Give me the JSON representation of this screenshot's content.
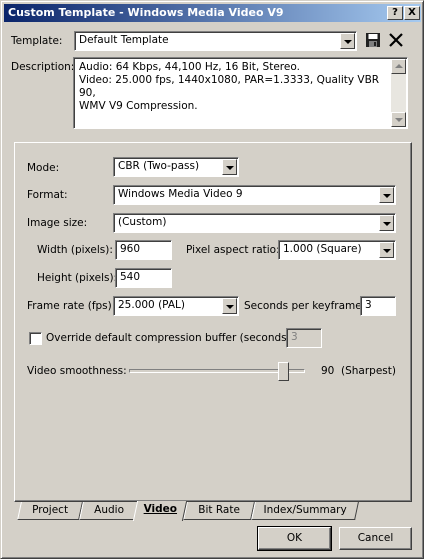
{
  "window": {
    "title": "Custom Template - Windows Media Video V9",
    "help_label": "?",
    "close_label": "X"
  },
  "template": {
    "label": "Template:",
    "value": "Default Template",
    "save_icon": "floppy-save-icon",
    "delete_icon": "delete-x-icon"
  },
  "description": {
    "label": "Description:",
    "text": "Audio: 64 Kbps, 44,100 Hz, 16 Bit, Stereo.\nVideo: 25.000 fps, 1440x1080, PAR=1.3333, Quality VBR 90,\nWMV V9 Compression."
  },
  "video": {
    "mode_label": "Mode:",
    "mode_value": "CBR (Two-pass)",
    "format_label": "Format:",
    "format_value": "Windows Media Video 9",
    "image_size_label": "Image size:",
    "image_size_value": "(Custom)",
    "width_label": "Width (pixels):",
    "width_value": "960",
    "par_label": "Pixel aspect ratio:",
    "par_value": "1.000 (Square)",
    "height_label": "Height (pixels):",
    "height_value": "540",
    "frame_rate_label": "Frame rate (fps):",
    "frame_rate_value": "25.000 (PAL)",
    "keyframe_label": "Seconds per keyframe:",
    "keyframe_value": "3",
    "override_label": "Override default compression buffer (seconds):",
    "override_checked": false,
    "override_value": "3",
    "smoothness_label": "Video smoothness:",
    "smoothness_value": "90",
    "smoothness_desc": "(Sharpest)"
  },
  "tabs": [
    {
      "label": "Project"
    },
    {
      "label": "Audio"
    },
    {
      "label": "Video",
      "active": true
    },
    {
      "label": "Bit Rate"
    },
    {
      "label": "Index/Summary"
    }
  ],
  "buttons": {
    "ok": "OK",
    "cancel": "Cancel"
  },
  "colors": {
    "title_start": "#0a246a",
    "title_end": "#a6caf0",
    "face": "#d4d0c8"
  }
}
